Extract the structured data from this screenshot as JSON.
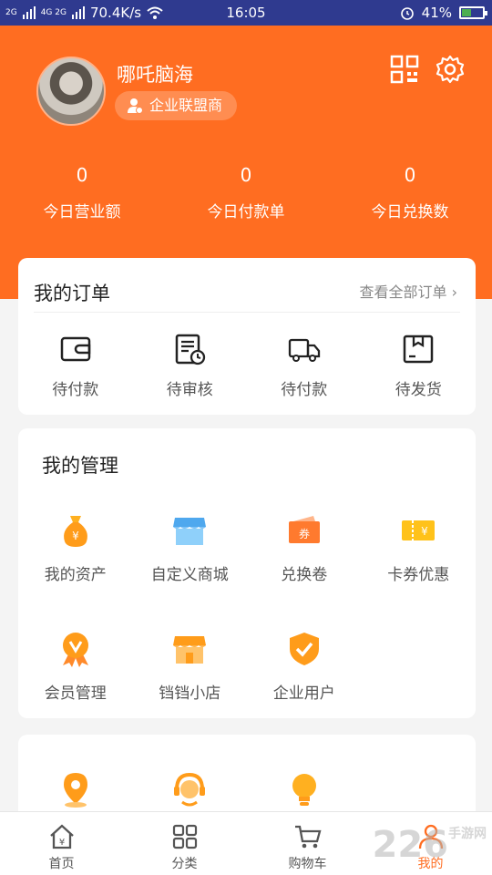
{
  "status_bar": {
    "signal_1": "2G",
    "signal_2": "4G 2G",
    "network_speed": "70.4K/s",
    "time": "16:05",
    "battery": "41%"
  },
  "profile": {
    "name": "哪吒脑海",
    "badge": "企业联盟商"
  },
  "stats": [
    {
      "value": "0",
      "label": "今日营业额"
    },
    {
      "value": "0",
      "label": "今日付款单"
    },
    {
      "value": "0",
      "label": "今日兑换数"
    }
  ],
  "orders": {
    "title": "我的订单",
    "view_all": "查看全部订单",
    "items": [
      {
        "label": "待付款",
        "icon": "wallet-icon"
      },
      {
        "label": "待审核",
        "icon": "review-doc-icon"
      },
      {
        "label": "待付款",
        "icon": "truck-icon"
      },
      {
        "label": "待发货",
        "icon": "package-icon"
      }
    ]
  },
  "management": {
    "title": "我的管理",
    "items": [
      {
        "label": "我的资产",
        "icon": "money-bag-icon"
      },
      {
        "label": "自定义商城",
        "icon": "store-icon"
      },
      {
        "label": "兑换卷",
        "icon": "voucher-icon"
      },
      {
        "label": "卡券优惠",
        "icon": "coupon-icon"
      },
      {
        "label": "会员管理",
        "icon": "member-badge-icon"
      },
      {
        "label": "铛铛小店",
        "icon": "shop-icon"
      },
      {
        "label": "企业用户",
        "icon": "shield-check-icon"
      }
    ]
  },
  "extra": {
    "icons": [
      "location-pin-icon",
      "customer-service-icon",
      "lightbulb-icon"
    ]
  },
  "tabbar": {
    "items": [
      {
        "label": "首页",
        "icon": "home-icon"
      },
      {
        "label": "分类",
        "icon": "category-icon"
      },
      {
        "label": "购物车",
        "icon": "cart-icon"
      },
      {
        "label": "我的",
        "icon": "user-icon"
      }
    ],
    "active_index": 3
  },
  "watermark": {
    "text": "226",
    "sub": "手游网"
  },
  "colors": {
    "primary": "#ff6d21",
    "status_bar": "#2f3a8f",
    "icon_orange": "#ff9c1a"
  }
}
